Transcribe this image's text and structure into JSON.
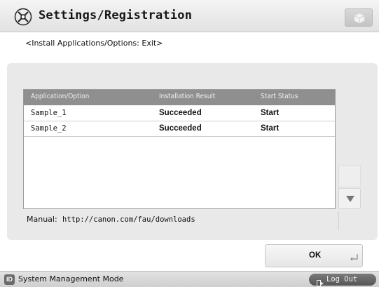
{
  "header": {
    "title": "Settings/Registration",
    "icon": "settings-wrench-icon",
    "right_button_icon": "cube-icon"
  },
  "subtitle": "<Install Applications/Options: Exit>",
  "table": {
    "columns": [
      "Application/Option",
      "Installation Result",
      "Start Status"
    ],
    "rows": [
      {
        "name": "Sample_1",
        "result": "Succeeded",
        "status": "Start"
      },
      {
        "name": "Sample_2",
        "result": "Succeeded",
        "status": "Start"
      }
    ]
  },
  "scroll": {
    "down_icon": "triangle-down-icon"
  },
  "manual": {
    "label": "Manual:",
    "url": "http://canon.com/fau/downloads"
  },
  "ok_button": {
    "label": "OK"
  },
  "footer": {
    "mode_badge": "ID",
    "mode_label": "System Management Mode",
    "logout_label": "Log Out"
  },
  "colors": {
    "header_bg": "#e8e8e8",
    "panel_bg": "#e9e9e9",
    "table_header_bg": "#8f8f8f",
    "logout_bg": "#666666"
  }
}
